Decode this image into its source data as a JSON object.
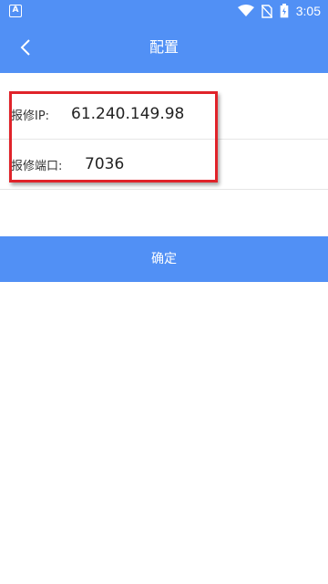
{
  "status_bar": {
    "time": "3:05",
    "notification_icon": "a-icon",
    "notification_letter": "A",
    "icons": [
      "wifi-icon",
      "no-sim-icon",
      "battery-icon"
    ]
  },
  "header": {
    "title": "配置",
    "back_icon": "chevron-left-icon"
  },
  "form": {
    "ip_label": "报修IP:",
    "ip_value": "61.240.149.98",
    "port_label": "报修端口:",
    "port_value": "7036"
  },
  "confirm_label": "确定",
  "colors": {
    "primary": "#5190f5",
    "highlight_border": "#e0232a"
  }
}
